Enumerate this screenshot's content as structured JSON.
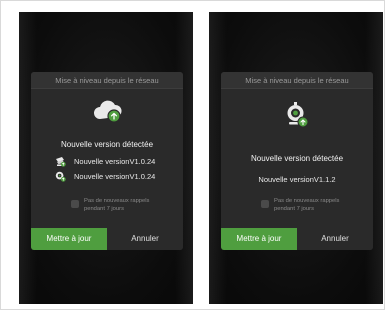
{
  "screens": [
    {
      "dialog_title": "Mise à niveau depuis le réseau",
      "hero_icon": "cloud-upload-icon",
      "detected_text": "Nouvelle version détectée",
      "versions": [
        {
          "icon": "camera-stack-icon",
          "label": "Nouvelle versionV1.0.24"
        },
        {
          "icon": "camera-upload-icon",
          "label": "Nouvelle versionV1.0.24"
        }
      ],
      "remind_text": "Pas de nouveaux rappels pendant 7 jours",
      "update_button": "Mettre à jour",
      "cancel_button": "Annuler"
    },
    {
      "dialog_title": "Mise à niveau depuis le réseau",
      "hero_icon": "camera-upload-icon",
      "detected_text": "Nouvelle version détectée",
      "version_text": "Nouvelle versionV1.1.2",
      "remind_text": "Pas de nouveaux rappels pendant 7 jours",
      "update_button": "Mettre à jour",
      "cancel_button": "Annuler"
    }
  ],
  "colors": {
    "accent": "#4f9e3f",
    "dialog_bg": "#2a2a2a",
    "screen_bg": "#0c0c0c"
  }
}
